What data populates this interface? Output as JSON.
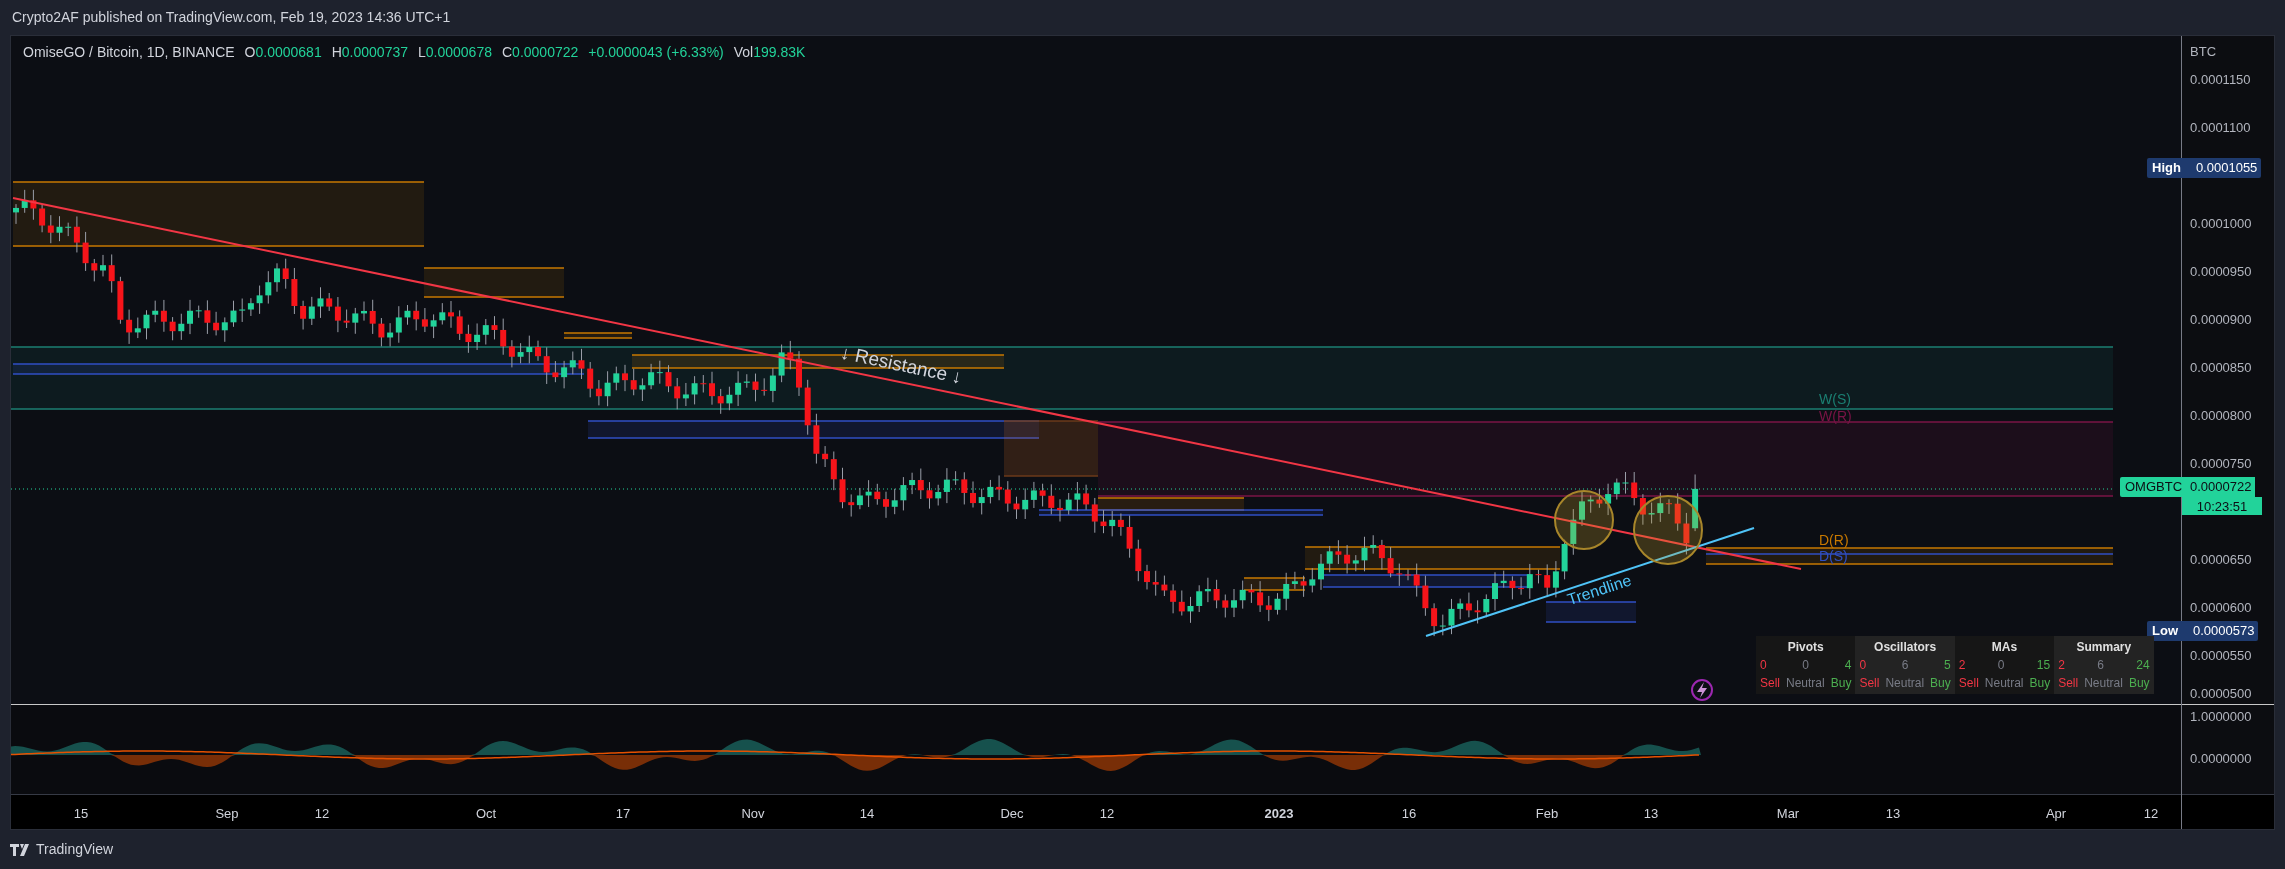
{
  "header": {
    "text": "Crypto2AF published on TradingView.com, Feb 19, 2023 14:36 UTC+1"
  },
  "legend": {
    "symbol": "OmiseGO / Bitcoin, 1D, BINANCE",
    "fields": [
      {
        "key": "O",
        "value": "0.0000681"
      },
      {
        "key": "H",
        "value": "0.0000737"
      },
      {
        "key": "L",
        "value": "0.0000678"
      },
      {
        "key": "C",
        "value": "0.0000722"
      }
    ],
    "change": "+0.0000043 (+6.33%)",
    "volume": {
      "key": "Vol",
      "value": "199.83K"
    }
  },
  "price_axis": {
    "unit": "BTC",
    "ticks": [
      "0.0001150",
      "0.0001100",
      "0.0001000",
      "0.0000950",
      "0.0000900",
      "0.0000850",
      "0.0000800",
      "0.0000750",
      "0.0000650",
      "0.0000600",
      "0.0000550",
      "0.0000500"
    ]
  },
  "price_tags": [
    {
      "kind": "high",
      "label": "High",
      "value": "0.0001055"
    },
    {
      "kind": "last",
      "label": "OMGBTC",
      "value": "0.0000722",
      "countdown": "10:23:51"
    },
    {
      "kind": "low",
      "label": "Low",
      "value": "0.0000573"
    }
  ],
  "annotations": [
    {
      "kind": "callout",
      "text": "↓ Resistance ↓"
    },
    {
      "kind": "trendline",
      "text": "Trendline"
    }
  ],
  "levels": [
    {
      "label": "W(S)",
      "color": "#1b7f72"
    },
    {
      "label": "W(R)",
      "color": "#7a1446"
    },
    {
      "label": "D(R)",
      "color": "#c77800"
    },
    {
      "label": "D(S)",
      "color": "#2f4fc4"
    }
  ],
  "oscillator_axis": [
    "1.0000000",
    "0.0000000"
  ],
  "technicals": [
    {
      "title": "Pivots",
      "sell": "0",
      "neutral": "0",
      "buy": "4",
      "sell_label": "Sell",
      "neutral_label": "Neutral",
      "buy_label": "Buy"
    },
    {
      "title": "Oscillators",
      "sell": "0",
      "neutral": "6",
      "buy": "5",
      "sell_label": "Sell",
      "neutral_label": "Neutral",
      "buy_label": "Buy"
    },
    {
      "title": "MAs",
      "sell": "2",
      "neutral": "0",
      "buy": "15",
      "sell_label": "Sell",
      "neutral_label": "Neutral",
      "buy_label": "Buy"
    },
    {
      "title": "Summary",
      "sell": "2",
      "neutral": "6",
      "buy": "24",
      "sell_label": "Sell",
      "neutral_label": "Neutral",
      "buy_label": "Buy"
    }
  ],
  "time_axis": [
    {
      "label": "15",
      "bold": false
    },
    {
      "label": "Sep",
      "bold": false
    },
    {
      "label": "12",
      "bold": false
    },
    {
      "label": "Oct",
      "bold": false
    },
    {
      "label": "17",
      "bold": false
    },
    {
      "label": "Nov",
      "bold": false
    },
    {
      "label": "14",
      "bold": false
    },
    {
      "label": "Dec",
      "bold": false
    },
    {
      "label": "12",
      "bold": false
    },
    {
      "label": "2023",
      "bold": true
    },
    {
      "label": "16",
      "bold": false
    },
    {
      "label": "Feb",
      "bold": false
    },
    {
      "label": "13",
      "bold": false
    },
    {
      "label": "Mar",
      "bold": false
    },
    {
      "label": "13",
      "bold": false
    },
    {
      "label": "Apr",
      "bold": false
    },
    {
      "label": "12",
      "bold": false
    }
  ],
  "footer": {
    "brand": "TradingView"
  }
}
